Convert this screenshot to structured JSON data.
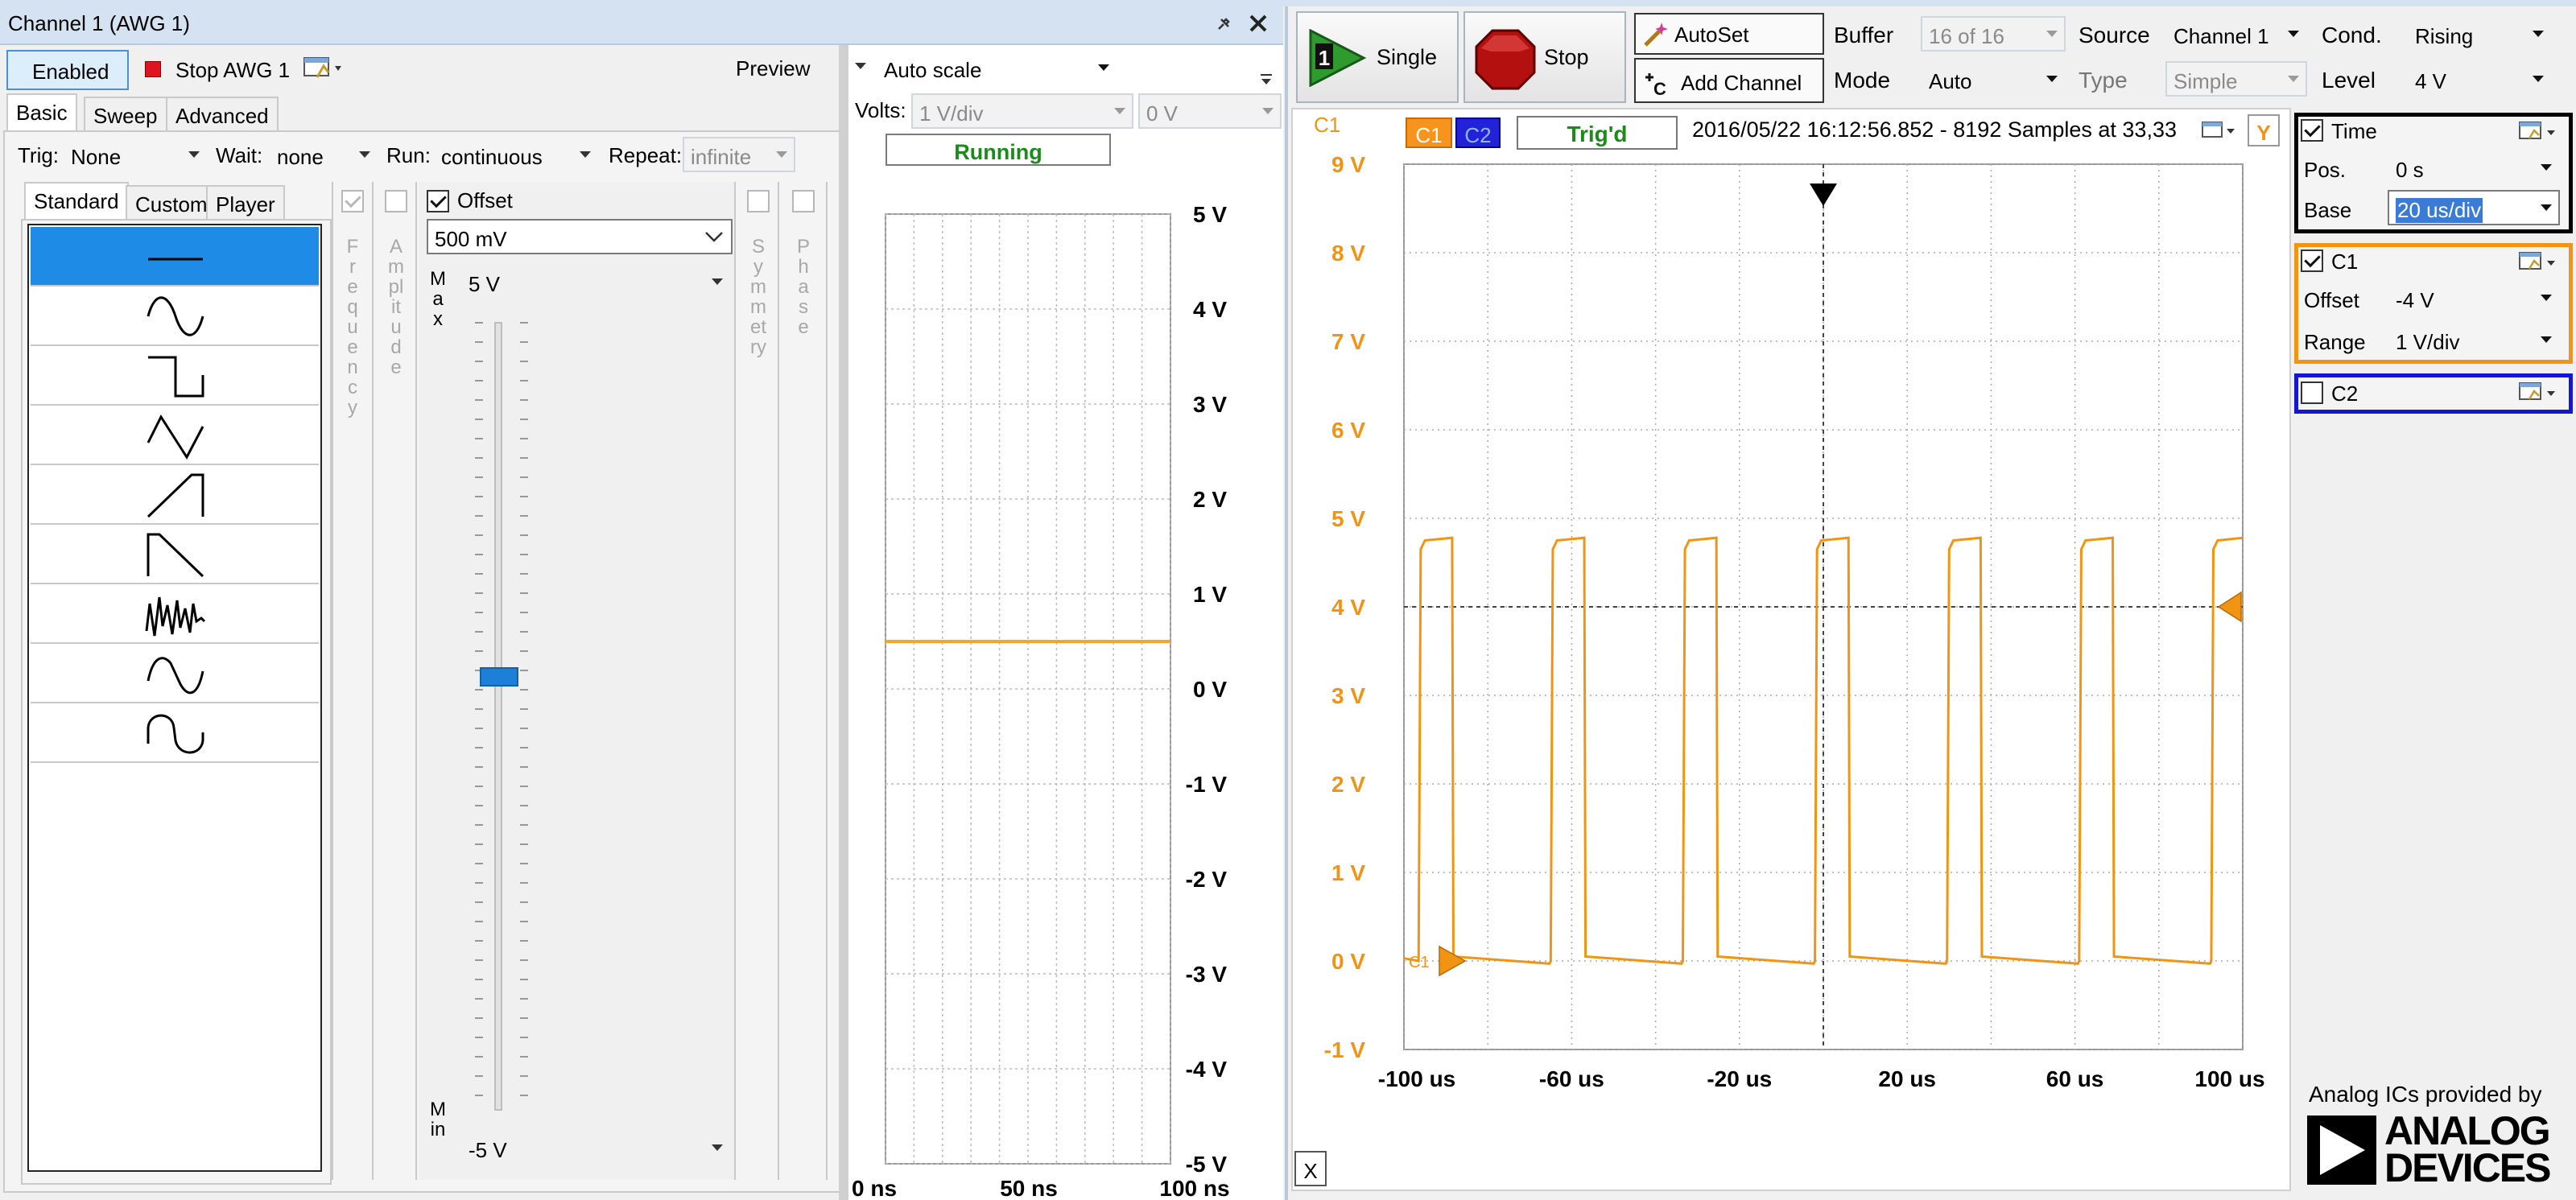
{
  "awg": {
    "title": "Channel 1 (AWG 1)",
    "enabled_label": "Enabled",
    "stop_label": "Stop AWG 1",
    "preview_label": "Preview",
    "tabs": [
      "Basic",
      "Sweep",
      "Advanced"
    ],
    "trig_label": "Trig:",
    "trig_value": "None",
    "wait_label": "Wait:",
    "wait_value": "none",
    "run_label": "Run:",
    "run_value": "continuous",
    "repeat_label": "Repeat:",
    "repeat_value": "infinite",
    "wave_tabs": [
      "Standard",
      "Custom",
      "Player"
    ],
    "waveforms": [
      "dc",
      "sine",
      "square",
      "triangle",
      "ramp-up",
      "ramp-down",
      "noise",
      "trapezium",
      "sine-power"
    ],
    "selected_waveform": "dc",
    "vertical_labels": {
      "frequency": "Frequency",
      "amplitude": "Amplitude",
      "max": "Max",
      "min": "Min",
      "symmetry": "Symmetry",
      "phase": "Phase"
    },
    "offset": {
      "label": "Offset",
      "checked": true,
      "value": "500 mV",
      "max": "5 V",
      "min": "-5 V",
      "slider_fraction": 0.55
    }
  },
  "preview": {
    "scale_mode": "Auto scale",
    "volts_label": "Volts:",
    "volts_per_div": "1 V/div",
    "offset": "0 V",
    "status": "Running",
    "y_ticks": [
      "5 V",
      "4 V",
      "3 V",
      "2 V",
      "1 V",
      "0 V",
      "-1 V",
      "-2 V",
      "-3 V",
      "-4 V",
      "-5 V"
    ],
    "x_ticks": [
      "0 ns",
      "50 ns",
      "100 ns"
    ],
    "trace_color": "#f5a623"
  },
  "toolbar": {
    "single_label": "Single",
    "stop_label": "Stop",
    "autoset_label": "AutoSet",
    "add_channel_label": "Add Channel",
    "buffer_label": "Buffer",
    "buffer_value": "16 of 16",
    "mode_label": "Mode",
    "mode_value": "Auto",
    "source_label": "Source",
    "source_value": "Channel 1",
    "type_label": "Type",
    "type_value": "Simple",
    "cond_label": "Cond.",
    "cond_value": "Rising",
    "level_label": "Level",
    "level_value": "4 V"
  },
  "scope": {
    "channel_label": "C1",
    "c1_badge": "C1",
    "c2_badge": "C2",
    "trigger_status": "Trig'd",
    "info": "2016/05/22  16:12:56.852 - 8192 Samples at 33,33 ",
    "y_button": "Y",
    "x_button": "X",
    "marker_label": "C1",
    "y_ticks": [
      "9 V",
      "8 V",
      "7 V",
      "6 V",
      "5 V",
      "4 V",
      "3 V",
      "2 V",
      "1 V",
      "0 V",
      "-1 V"
    ],
    "x_ticks": [
      "-100 us",
      "-60 us",
      "-20 us",
      "20 us",
      "60 us",
      "100 us"
    ],
    "trace_color": "#f29413"
  },
  "chart_data": {
    "type": "line",
    "title": "",
    "xlabel": "",
    "ylabel": "",
    "xlim": [
      -100,
      100
    ],
    "ylim": [
      -1,
      9
    ],
    "x_unit": "us",
    "y_unit": "V",
    "grid": true,
    "period_us": 31.5,
    "high_duration_us": 8,
    "pulse_rise_us": [
      -96.5,
      -65,
      -33.5,
      -2,
      29.5,
      61,
      92.5
    ],
    "high_level_v": 4.75,
    "low_level_v": 0,
    "trigger_level_v": 4,
    "trigger_position_us": 0
  },
  "settings": {
    "time_label": "Time",
    "time_checked": true,
    "pos_label": "Pos.",
    "pos_value": "0 s",
    "base_label": "Base",
    "base_value": "20 us/div",
    "c1_label": "C1",
    "c1_checked": true,
    "c1_offset_label": "Offset",
    "c1_offset_value": "-4 V",
    "c1_range_label": "Range",
    "c1_range_value": "1 V/div",
    "c2_label": "C2",
    "c2_checked": false,
    "time_border": "#000000",
    "c1_border": "#f29413",
    "c2_border": "#1515d6"
  },
  "branding": {
    "tagline": "Analog ICs provided by",
    "logo_text_1": "ANALOG",
    "logo_text_2": "DEVICES"
  }
}
